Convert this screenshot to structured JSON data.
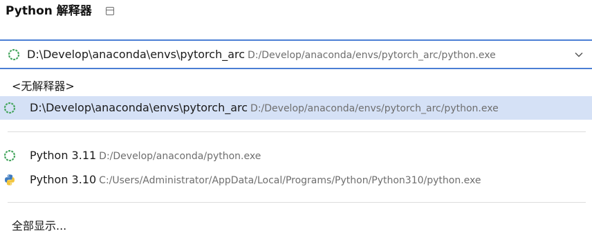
{
  "header": {
    "title": "Python 解释器"
  },
  "combo": {
    "name": "D:\\Develop\\anaconda\\envs\\pytorch_arc",
    "path": "D:/Develop/anaconda/envs/pytorch_arc/python.exe"
  },
  "dropdown": {
    "no_interpreter_label": "<无解释器>",
    "items": [
      {
        "name": "D:\\Develop\\anaconda\\envs\\pytorch_arc",
        "path": "D:/Develop/anaconda/envs/pytorch_arc/python.exe",
        "icon": "conda-icon",
        "selected": true
      },
      {
        "name": "Python 3.11",
        "path": "D:/Develop/anaconda/python.exe",
        "icon": "conda-icon",
        "selected": false
      },
      {
        "name": "Python 3.10",
        "path": "C:/Users/Administrator/AppData/Local/Programs/Python/Python310/python.exe",
        "icon": "python-icon",
        "selected": false
      }
    ],
    "show_all_label": "全部显示..."
  },
  "colors": {
    "accent": "#4a7ed4",
    "selected_bg": "#d5e1f6",
    "conda_green": "#44a55d",
    "secondary_text": "#6e6e6e"
  }
}
